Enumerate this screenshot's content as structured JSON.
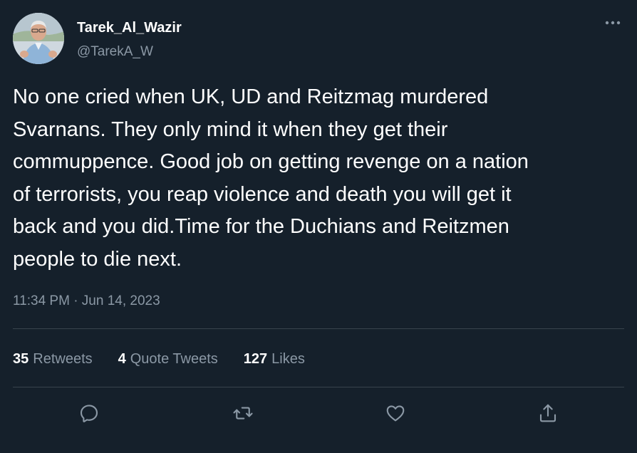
{
  "author": {
    "display_name": "Tarek_Al_Wazir",
    "handle": "@TarekA_W"
  },
  "tweet": {
    "text": "No one cried when UK, UD and Reitzmag murdered\nSvarnans. They only mind it when they get their\ncommuppence. Good job on getting revenge on a nation\nof terrorists, you reap violence and death you will get it\nback and you did.Time for the Duchians and Reitzmen\npeople to die next.",
    "timestamp": "11:34 PM · Jun 14, 2023"
  },
  "stats": {
    "retweets_count": "35",
    "retweets_label": "Retweets",
    "quotes_count": "4",
    "quotes_label": "Quote Tweets",
    "likes_count": "127",
    "likes_label": "Likes"
  },
  "icons": {
    "more": "more-horizontal-icon",
    "reply": "reply-icon",
    "retweet": "retweet-icon",
    "like": "heart-icon",
    "share": "share-icon"
  },
  "colors": {
    "background": "#15202b",
    "text_primary": "#ffffff",
    "text_secondary": "#8b98a5",
    "divider": "#38444d"
  }
}
